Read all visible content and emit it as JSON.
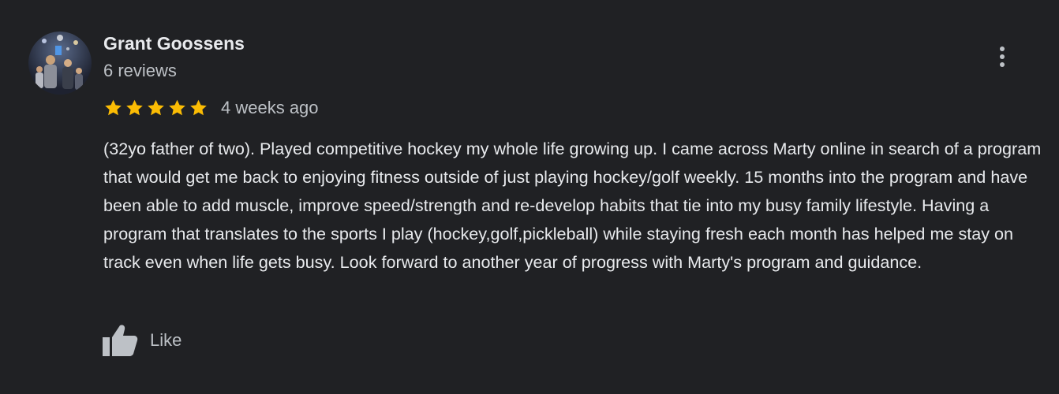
{
  "review": {
    "reviewer_name": "Grant Goossens",
    "review_count": "6 reviews",
    "rating": 5,
    "rating_max": 5,
    "date": "4 weeks ago",
    "text": "(32yo father of two). Played competitive hockey my whole life growing up. I came across Marty online in search of a program that would get me back to enjoying fitness outside of just playing hockey/golf weekly. 15 months into the program and have been able to add muscle, improve speed/strength and re-develop habits that tie into my busy family lifestyle. Having a program that translates to the sports I play (hockey,golf,pickleball) while staying fresh each month has helped me stay on track even when life gets busy. Look forward to another year of progress with Marty's program and guidance.",
    "like_label": "Like"
  },
  "icons": {
    "more": "more-vert-icon",
    "like": "thumbs-up-icon",
    "star": "star-icon"
  },
  "colors": {
    "background": "#202124",
    "primary_text": "#e8eaed",
    "secondary_text": "#bdc1c6",
    "star": "#fbbc04"
  }
}
